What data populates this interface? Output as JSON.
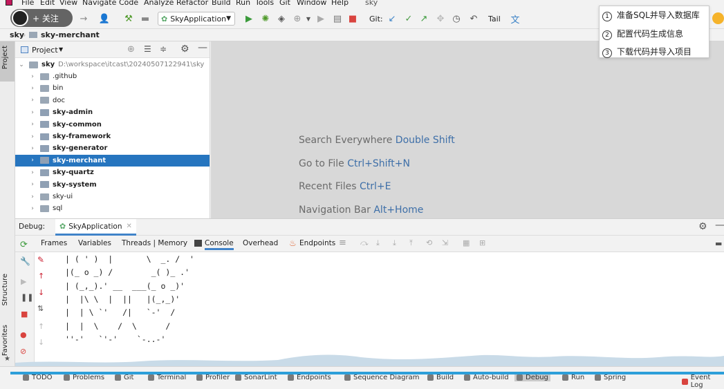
{
  "window_title": "sky",
  "menu": [
    "File",
    "Edit",
    "View",
    "Navigate",
    "Code",
    "Analyze",
    "Refactor",
    "Build",
    "Run",
    "Tools",
    "Git",
    "Window",
    "Help"
  ],
  "follow_overlay": {
    "label": "+ 关注"
  },
  "toolbar": {
    "run_config": "SkyApplication",
    "git_label": "Git:",
    "tail_label": "Tail"
  },
  "breadcrumb": {
    "root": "sky",
    "module": "sky-merchant"
  },
  "project_panel": {
    "title": "Project",
    "root": {
      "name": "sky",
      "path": "D:\\workspace\\itcast\\20240507122941\\sky"
    },
    "items": [
      {
        "name": ".github",
        "bold": false,
        "selected": false
      },
      {
        "name": "bin",
        "bold": false,
        "selected": false
      },
      {
        "name": "doc",
        "bold": false,
        "selected": false
      },
      {
        "name": "sky-admin",
        "bold": true,
        "selected": false
      },
      {
        "name": "sky-common",
        "bold": true,
        "selected": false
      },
      {
        "name": "sky-framework",
        "bold": true,
        "selected": false
      },
      {
        "name": "sky-generator",
        "bold": true,
        "selected": false
      },
      {
        "name": "sky-merchant",
        "bold": true,
        "selected": true
      },
      {
        "name": "sky-quartz",
        "bold": true,
        "selected": false
      },
      {
        "name": "sky-system",
        "bold": true,
        "selected": false
      },
      {
        "name": "sky-ui",
        "bold": false,
        "selected": false
      },
      {
        "name": "sql",
        "bold": false,
        "selected": false
      }
    ]
  },
  "editor_hints": [
    {
      "label": "Search Everywhere",
      "key": "Double Shift"
    },
    {
      "label": "Go to File",
      "key": "Ctrl+Shift+N"
    },
    {
      "label": "Recent Files",
      "key": "Ctrl+E"
    },
    {
      "label": "Navigation Bar",
      "key": "Alt+Home"
    }
  ],
  "popup": {
    "items": [
      {
        "num": "1",
        "text": "准备SQL并导入数据库"
      },
      {
        "num": "2",
        "text": "配置代码生成信息"
      },
      {
        "num": "3",
        "text": "下载代码并导入项目"
      }
    ]
  },
  "debug": {
    "label": "Debug:",
    "session": "SkyApplication",
    "tabs": [
      "Frames",
      "Variables",
      "Threads | Memory",
      "Console",
      "Overhead",
      "Endpoints"
    ],
    "active_tab": "Console",
    "console_lines": [
      "| ( ' )  |       \\  _. /  '",
      "|(_ o _) /        _( )_ .'",
      "| (_,_).' __  ___(_ o _)'",
      "|  |\\ \\  |  ||   |(_,_)'",
      "|  | \\ `'   /|   `-'  /",
      "|  |  \\    /  \\      /",
      "''-'   `'-'    `-..-'"
    ]
  },
  "left_stripe": {
    "top_tab": "Project",
    "structure_tab": "Structure",
    "favorites_tab": "Favorites"
  },
  "statusbar": {
    "items": [
      "TODO",
      "Problems",
      "Git",
      "Terminal",
      "Profiler",
      "SonarLint",
      "Endpoints",
      "Sequence Diagram",
      "Build",
      "Auto-build",
      "Debug",
      "Run",
      "Spring"
    ],
    "active": "Debug",
    "event_log": "Event Log"
  },
  "colors": {
    "selection": "#2675bf",
    "accent": "#2d9fd9",
    "link_key": "#3e6fa8"
  }
}
